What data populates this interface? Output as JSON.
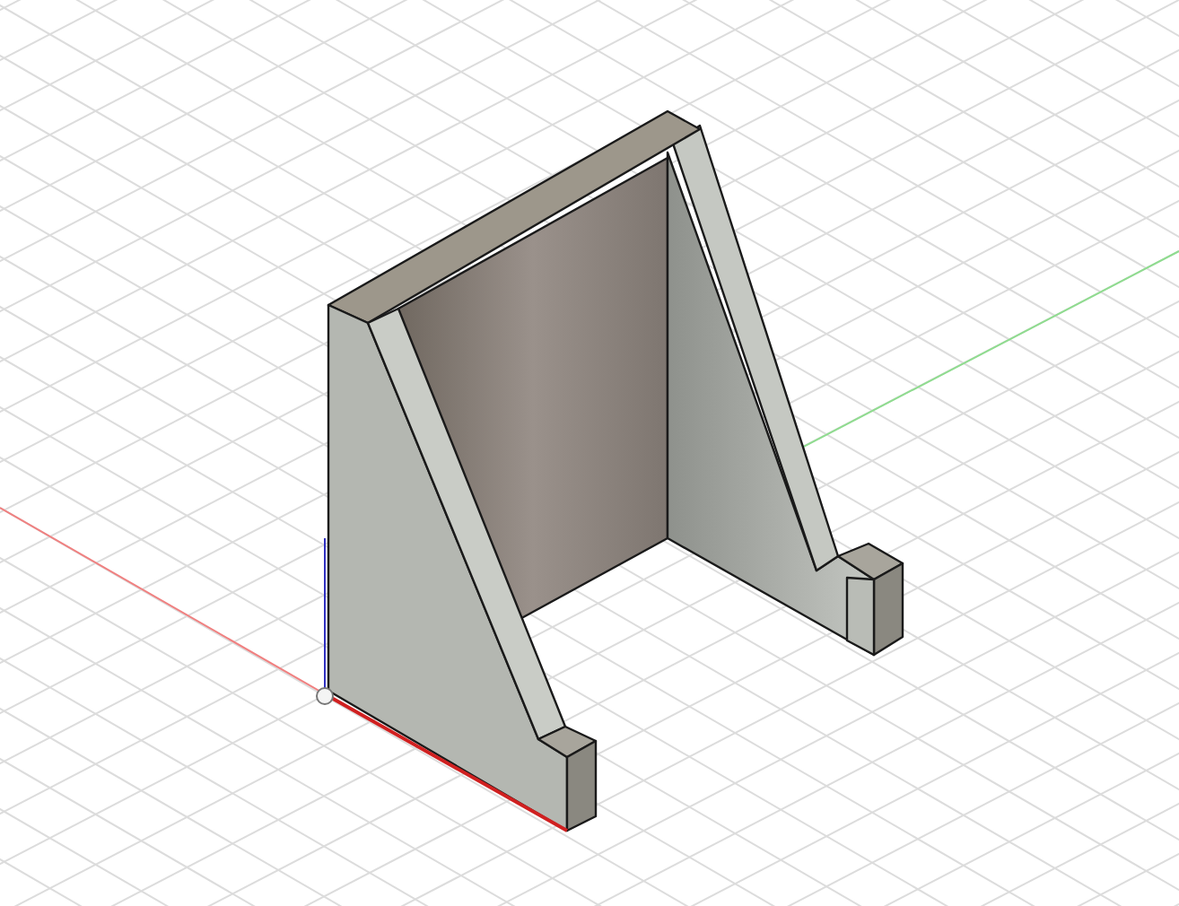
{
  "viewport": {
    "grid": true,
    "origin_marker": true
  }
}
